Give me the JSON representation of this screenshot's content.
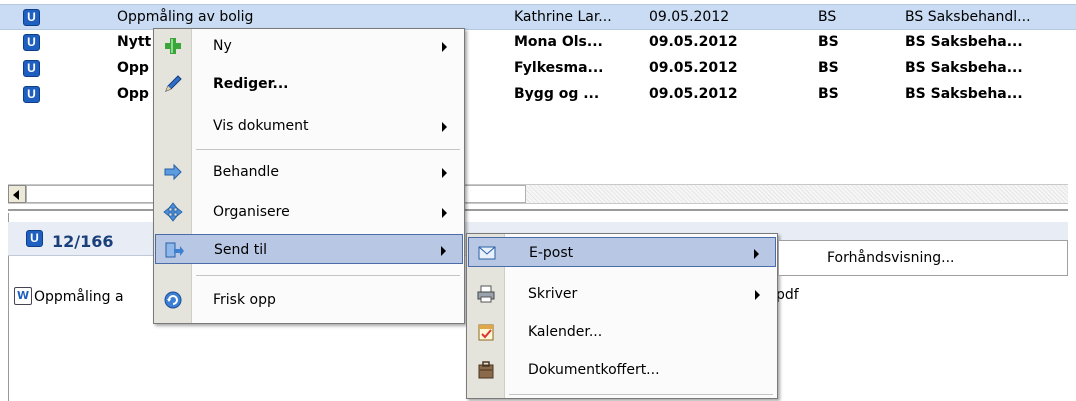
{
  "documents": [
    {
      "title": "Oppmåling av bolig",
      "from": "Kathrine Lar...",
      "date": "09.05.2012",
      "unit": "BS",
      "case": "BS Saksbehandl...",
      "selected": true,
      "bold": false
    },
    {
      "title": "Nytt",
      "from": "Mona Ols...",
      "date": "09.05.2012",
      "unit": "BS",
      "case": "BS Saksbeha...",
      "selected": false,
      "bold": true
    },
    {
      "title": "Opp",
      "from": "Fylkesma...",
      "date": "09.05.2012",
      "unit": "BS",
      "case": "BS Saksbeha...",
      "selected": false,
      "bold": true
    },
    {
      "title": "Opp",
      "from": "Bygg og ...",
      "date": "09.05.2012",
      "unit": "BS",
      "case": "BS Saksbeha...",
      "selected": false,
      "bold": true
    }
  ],
  "row_icon_letter": "U",
  "detail": {
    "count": "12/166",
    "attachment_name": "Oppmåling a",
    "attachment_ext": "pdf"
  },
  "context_menu": [
    {
      "label": "Ny",
      "icon": "plus-icon",
      "submenu": true
    },
    {
      "label": "Rediger...",
      "icon": "pencil-icon",
      "submenu": false
    },
    {
      "label": "Vis dokument",
      "icon": "",
      "submenu": true
    },
    {
      "label": "Behandle",
      "icon": "arrow-forward-icon",
      "submenu": true
    },
    {
      "label": "Organisere",
      "icon": "move-icon",
      "submenu": true
    },
    {
      "label": "Send til",
      "icon": "send-icon",
      "submenu": true,
      "highlighted": true
    },
    {
      "label": "Frisk opp",
      "icon": "refresh-icon",
      "submenu": false
    }
  ],
  "send_to_menu": [
    {
      "label": "E-post",
      "icon": "envelope-icon",
      "submenu": true,
      "highlighted": true
    },
    {
      "label": "Skriver",
      "icon": "printer-icon",
      "submenu": true
    },
    {
      "label": "Kalender...",
      "icon": "calendar-icon",
      "submenu": false
    },
    {
      "label": "Dokumentkoffert...",
      "icon": "briefcase-icon",
      "submenu": false
    }
  ],
  "email_menu": {
    "preview_label": "Forhåndsvisning..."
  },
  "colors": {
    "selection": "#c9dcf3",
    "menu_highlight": "#b8c8e4",
    "icon_blue": "#1f5fbf"
  }
}
